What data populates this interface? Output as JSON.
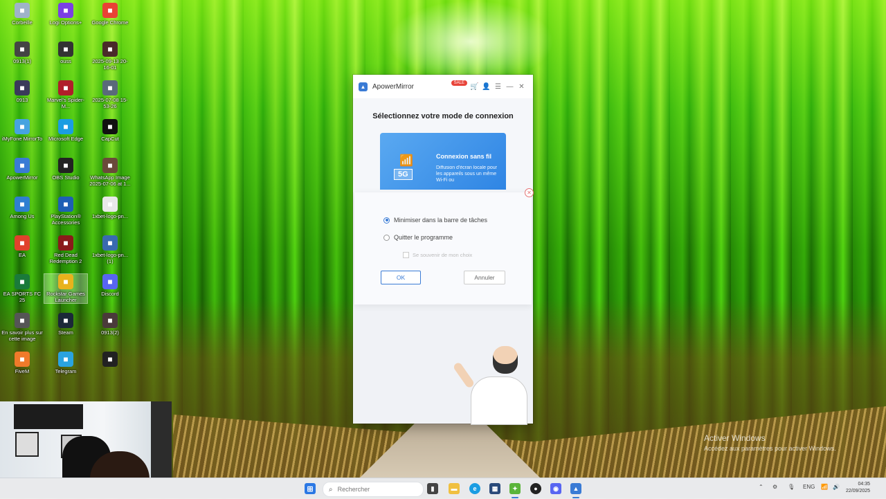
{
  "desktop": {
    "icons": [
      {
        "label": "Corbeille",
        "icon": "recycle-bin-icon",
        "color": "#9fb3c8"
      },
      {
        "label": "Logi Options+",
        "icon": "logi-icon",
        "color": "#7b3fe4"
      },
      {
        "label": "Google Chrome",
        "icon": "chrome-icon",
        "color": "#e94235"
      },
      {
        "label": "0913(1)",
        "icon": "video-file-icon",
        "color": "#444"
      },
      {
        "label": "ouss",
        "icon": "video-file-icon",
        "color": "#333"
      },
      {
        "label": "2025-09-13 20-16-01",
        "icon": "video-file-icon",
        "color": "#4a2a2a"
      },
      {
        "label": "0913",
        "icon": "video-file-icon",
        "color": "#3a3a5a"
      },
      {
        "label": "Marvel's Spider-M...",
        "icon": "spiderman-icon",
        "color": "#b01e2a"
      },
      {
        "label": "2025-07-08 15-53-26",
        "icon": "image-file-icon",
        "color": "#5a6a7a"
      },
      {
        "label": "iMyFone MirrorTo",
        "icon": "mirrorto-icon",
        "color": "#46a3e0"
      },
      {
        "label": "Microsoft Edge",
        "icon": "edge-icon",
        "color": "#1b9de2"
      },
      {
        "label": "CapCut",
        "icon": "capcut-icon",
        "color": "#111"
      },
      {
        "label": "ApowerMirror",
        "icon": "apowermirror-icon",
        "color": "#3a7bd5"
      },
      {
        "label": "OBS Studio",
        "icon": "obs-icon",
        "color": "#222"
      },
      {
        "label": "WhatsApp Image 2025-07-06 at 1...",
        "icon": "image-file-icon",
        "color": "#6a4a3a"
      },
      {
        "label": "Among Us",
        "icon": "among-us-icon",
        "color": "#2f7fd1"
      },
      {
        "label": "PlayStation® Accessories",
        "icon": "playstation-icon",
        "color": "#1e5fb5"
      },
      {
        "label": "1xbet-logo-pn...",
        "icon": "image-file-icon",
        "color": "#e8e8e8"
      },
      {
        "label": "EA",
        "icon": "ea-icon",
        "color": "#e0422c"
      },
      {
        "label": "Red Dead Redemption 2",
        "icon": "rdr2-icon",
        "color": "#8a1a1a"
      },
      {
        "label": "1xbet-logo-pn... (1)",
        "icon": "image-file-icon",
        "color": "#3a6ab0"
      },
      {
        "label": "EA SPORTS FC 25",
        "icon": "fc25-icon",
        "color": "#1a7a3a"
      },
      {
        "label": "Rockstar Games Launcher",
        "icon": "rockstar-icon",
        "color": "#e8b21c"
      },
      {
        "label": "Discord",
        "icon": "discord-icon",
        "color": "#5865f2"
      },
      {
        "label": "En savoir plus sur cette image",
        "icon": "info-icon",
        "color": "#555"
      },
      {
        "label": "Steam",
        "icon": "steam-icon",
        "color": "#1b2838"
      },
      {
        "label": "0913(2)",
        "icon": "video-file-icon",
        "color": "#4a3a3a"
      },
      {
        "label": "FiveM",
        "icon": "fivem-icon",
        "color": "#f07a2a"
      },
      {
        "label": "Telegram",
        "icon": "telegram-icon",
        "color": "#2aa3e0"
      },
      {
        "label": "",
        "icon": "epic-games-icon",
        "color": "#222"
      }
    ]
  },
  "app": {
    "title": "ApowerMirror",
    "sale_badge": "SALE",
    "heading": "Sélectionnez votre mode de connexion",
    "card": {
      "badge": "5G",
      "title": "Connexion sans fil",
      "description": "Diffusion d'écran locale pour les appareils sous un même Wi-Fi ou"
    }
  },
  "dialog": {
    "option_minimize": "Minimiser dans la barre de tâches",
    "option_quit": "Quitter le programme",
    "remember": "Se souvenir de mon choix",
    "ok_label": "OK",
    "cancel_label": "Annuler",
    "selected": "minimize"
  },
  "activation": {
    "title": "Activer Windows",
    "subtitle": "Accédez aux paramètres pour activer Windows."
  },
  "taskbar": {
    "search_placeholder": "Rechercher",
    "language": "ENG",
    "time": "04:35",
    "date": "22/09/2025"
  },
  "colors": {
    "accent": "#3a7bd5",
    "sale": "#e8443a",
    "card_blue": "#2f85e4"
  }
}
